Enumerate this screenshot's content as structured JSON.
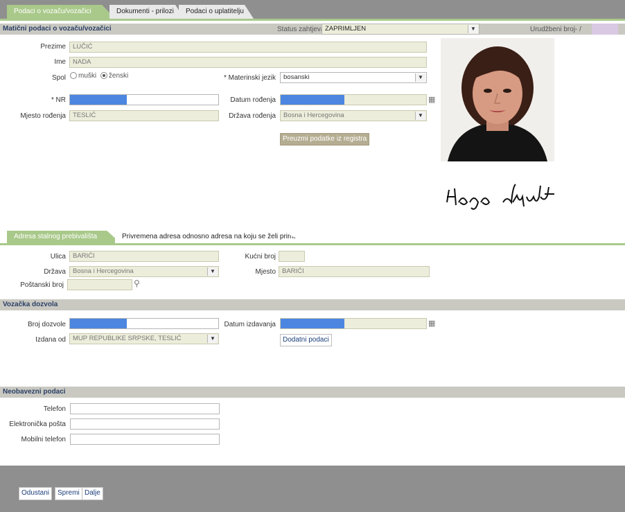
{
  "tabs": [
    {
      "label": "Podaci o vozaču/vozačici"
    },
    {
      "label": "Dokumenti - prilozi"
    },
    {
      "label": "Podaci o uplatitelju"
    }
  ],
  "header": {
    "title": "Matični podaci o vozaču/vozačici",
    "status_label": "Status zahtjeva",
    "status_value": "ZAPRIMLJEN",
    "urudzbeni_label": "Urudžbeni broj",
    "urudzbeni_value": "-  /"
  },
  "personal": {
    "prezime_label": "Prezime",
    "prezime_value": "LUČIĆ",
    "ime_label": "Ime",
    "ime_value": "NADA",
    "spol_label": "Spol",
    "spol_male": "muški",
    "spol_female": "ženski",
    "jezik_label": "* Materinski jezik",
    "jezik_value": "bosanski",
    "nr_label": "* NR",
    "datum_rodenja_label": "Datum rođenja",
    "mjesto_rodenja_label": "Mjesto rođenja",
    "mjesto_rodenja_value": "TESLIĆ",
    "drzava_rodenja_label": "Država rođenja",
    "drzava_rodenja_value": "Bosna i Hercegovina",
    "preuzmi_button": "Preuzmi podatke iz registra"
  },
  "address_tabs": [
    {
      "label": "Adresa stalnog prebivališta"
    },
    {
      "label": "Privremena adresa odnosno adresa na koju se želi primati pošta"
    }
  ],
  "address": {
    "ulica_label": "Ulica",
    "ulica_value": "BARIĆI",
    "kucni_broj_label": "Kućni broj",
    "drzava_label": "Država",
    "drzava_value": "Bosna i Hercegovina",
    "mjesto_label": "Mjesto",
    "mjesto_value": "BARIĆI",
    "postanski_label": "Poštanski broj"
  },
  "license": {
    "title": "Vozačka dozvola",
    "broj_label": "Broj dozvole",
    "datum_izdavanja_label": "Datum izdavanja",
    "izdana_label": "Izdana od",
    "izdana_value": "MUP REPUBLIKE SRPSKE, TESLIĆ",
    "dodatni_button": "Dodatni podaci"
  },
  "optional": {
    "title": "Neobavezni podaci",
    "telefon_label": "Telefon",
    "email_label": "Elektronička pošta",
    "mobilni_label": "Mobilni telefon"
  },
  "footer": {
    "odustani": "Odustani",
    "spremi": "Spremi",
    "dalje": "Dalje"
  },
  "colors": {
    "accent_green": "#a9c98a",
    "section_bg": "#c9c9c2",
    "readonly_field": "#ededdb",
    "footer_bg": "#8f8f8f"
  }
}
